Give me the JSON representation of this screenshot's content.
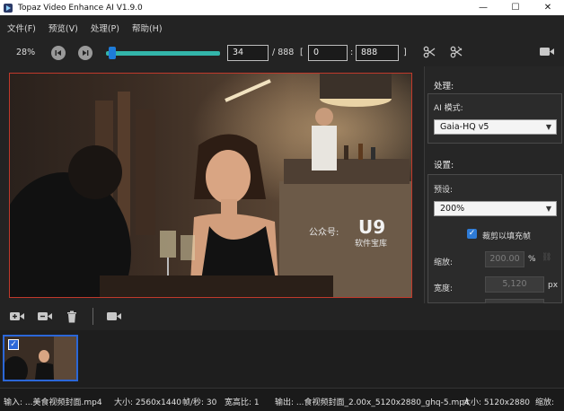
{
  "window": {
    "title": "Topaz Video Enhance AI V1.9.0",
    "controls": [
      "—",
      "☐",
      "✕"
    ]
  },
  "menu": [
    "文件(F)",
    "预览(V)",
    "处理(P)",
    "帮助(H)"
  ],
  "toolbar": {
    "zoom": "28%",
    "prev_icon": "skip-back-icon",
    "next_icon": "skip-forward-icon",
    "slider_fraction": 0.0383,
    "current_frame": "34",
    "total_frames": "/ 888",
    "range_open": "[",
    "range_start": "0",
    "range_colon": ":",
    "range_end": "888",
    "range_close": "]"
  },
  "preview": {
    "watermark_text": "公众号:",
    "watermark_brand": "U9",
    "watermark_sub": "软件宝库"
  },
  "panel": {
    "process_label": "处理:",
    "ai_mode_label": "AI 模式:",
    "ai_mode_value": "Gaia-HQ v5",
    "settings_label": "设置:",
    "preset_label": "预设:",
    "preset_value": "200%",
    "crop_label": "裁剪以填充帧",
    "crop_checked": true,
    "scale_label": "缩放:",
    "scale_value": "200.00",
    "scale_unit": "%",
    "width_label": "宽度:",
    "width_value": "5,120",
    "width_unit": "px"
  },
  "status": {
    "input": "输入: ...美食视频封面.mp4",
    "size_in": "大小: 2560x1440",
    "fps": "帧/秒: 30",
    "aspect": "宽高比: 1",
    "output": "输出: ...食视频封面_2.00x_5120x2880_ghq-5.mp4",
    "size_out": "大小: 5120x2880",
    "scale": "缩放:"
  },
  "colors": {
    "accent": "#2e7bd6",
    "slider": "#33b5aa",
    "frame_border": "#c0392b"
  }
}
